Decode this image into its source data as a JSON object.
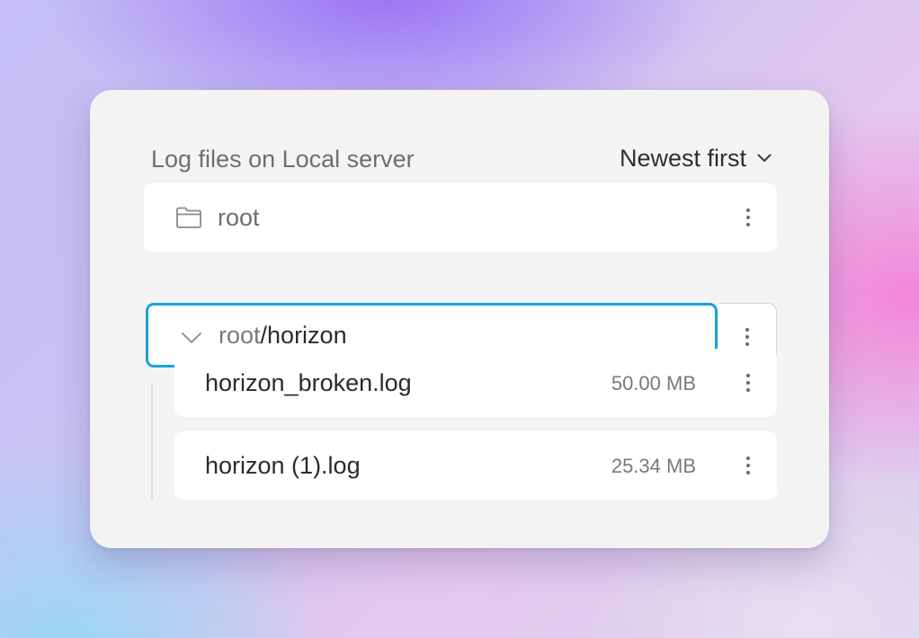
{
  "header": {
    "title": "Log files on Local server",
    "sort_label": "Newest first"
  },
  "tree": {
    "root_folder": {
      "label": "root",
      "icon": "folder-icon"
    },
    "open_folder": {
      "root_part": "root",
      "path_part": "/horizon",
      "icon": "chevron-down-icon"
    },
    "files": [
      {
        "name": "horizon_broken.log",
        "size": "50.00 MB"
      },
      {
        "name": "horizon (1).log",
        "size": "25.34 MB"
      }
    ]
  },
  "colors": {
    "selection_border": "#1ba0dc",
    "panel_background": "#f3f3f3"
  }
}
